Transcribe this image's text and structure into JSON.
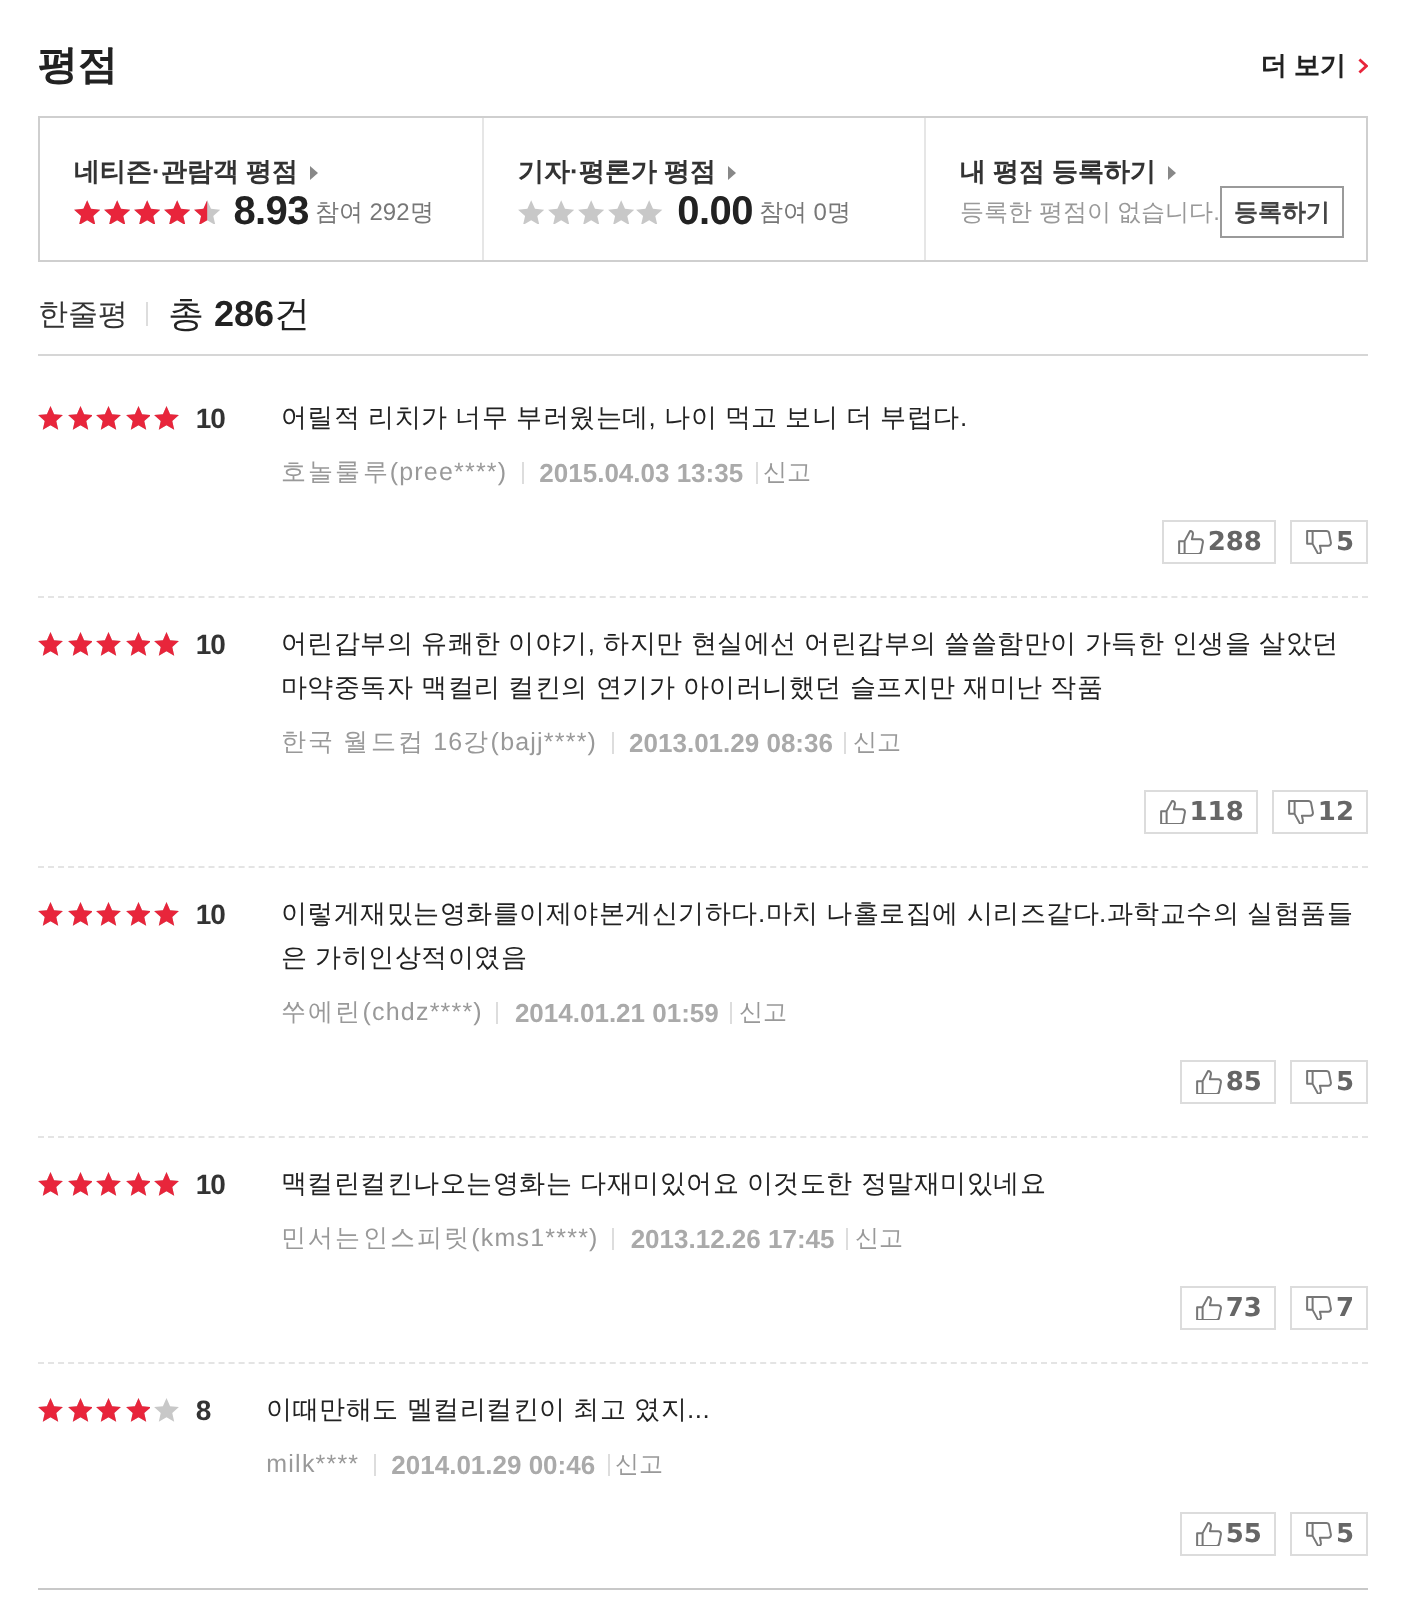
{
  "section": {
    "title": "평점",
    "more_link": "더 보기"
  },
  "summary": [
    {
      "kind": "score",
      "label": "네티즌·관람객 평점",
      "stars": 4.5,
      "score": "8.93",
      "participants": "참여 292명"
    },
    {
      "kind": "score",
      "label": "기자·평론가 평점",
      "stars": 0,
      "score": "0.00",
      "participants": "참여 0명"
    },
    {
      "kind": "register",
      "label": "내 평점 등록하기",
      "message": "등록한 평점이 없습니다.",
      "button": "등록하기"
    }
  ],
  "review_header": {
    "title": "한줄평",
    "total": "총 **286**건"
  },
  "reviews": [
    {
      "stars": 5,
      "score": "10",
      "text": "어릴적 리치가 너무 부러웠는데, 나이 먹고 보니 더 부럽다.",
      "author": "호놀룰루(pree****)",
      "date": "2015.04.03 13:35",
      "report": "신고",
      "likes": "288",
      "dislikes": "5"
    },
    {
      "stars": 5,
      "score": "10",
      "text": "어린갑부의 유쾌한 이야기, 하지만 현실에선 어린갑부의 쓸쓸함만이 가득한 인생을 살았던 마약중독자 맥컬리 컬킨의 연기가 아이러니했던 슬프지만 재미난 작품",
      "author": "한국 월드컵 16강(bajj****)",
      "date": "2013.01.29 08:36",
      "report": "신고",
      "likes": "118",
      "dislikes": "12"
    },
    {
      "stars": 5,
      "score": "10",
      "text": "이렇게재밌는영화를이제야본게신기하다.마치 나홀로집에 시리즈같다.과학교수의 실험품들은 가히인상적이였음",
      "author": "쑤에린(chdz****)",
      "date": "2014.01.21 01:59",
      "report": "신고",
      "likes": "85",
      "dislikes": "5"
    },
    {
      "stars": 5,
      "score": "10",
      "text": "맥컬린컬킨나오는영화는 다재미있어요 이것도한 정말재미있네요",
      "author": "민서는인스피릿(kms1****)",
      "date": "2013.12.26 17:45",
      "report": "신고",
      "likes": "73",
      "dislikes": "7"
    },
    {
      "stars": 4,
      "score": "8",
      "text": "이때만해도 멜컬리컬킨이 최고 였지...",
      "author": "milk****",
      "date": "2014.01.29 00:46",
      "report": "신고",
      "likes": "55",
      "dislikes": "5"
    }
  ]
}
